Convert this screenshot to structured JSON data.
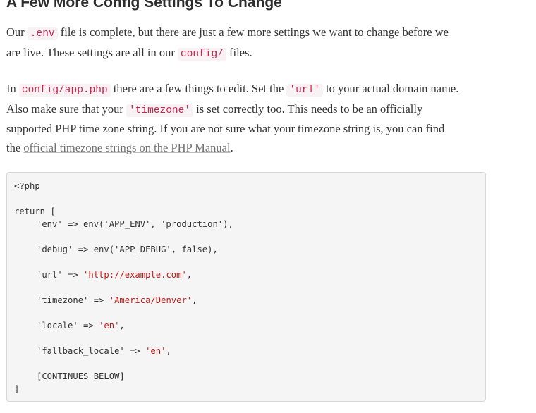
{
  "heading": "A Few More Config Settings To Change",
  "para1": {
    "line1": {
      "t1": "Our ",
      "c1": ".env",
      "t2": " file is complete, but there are just a few more settings we want to change before we"
    },
    "line2": {
      "t1": "are live. These settings are all in our ",
      "c1": "config/",
      "t2": " files."
    }
  },
  "para2": {
    "line1": {
      "t1": "In ",
      "c1": "config/app.php",
      "t2": " there are a few things to edit. Set the ",
      "c2": "'url'",
      "t3": " to your actual domain name."
    },
    "line2": {
      "t1": "Also make sure that your ",
      "c1": "'timezone'",
      "t2": " is set correctly too. This needs to be an officially"
    },
    "line3": {
      "t1": "supported PHP time zone string. If you are not sure what your timezone string is, you can find"
    },
    "line4": {
      "t1": "the ",
      "link": "official timezone strings on the PHP Manual",
      "t2": "."
    }
  },
  "code": {
    "open_tag": "<?php",
    "return_line": "return [",
    "env": {
      "key": "'env' => env('APP_ENV', 'production'),"
    },
    "debug": {
      "key": "'debug' => env('APP_DEBUG', false),"
    },
    "url": {
      "key": "'url' => ",
      "val": "'http://example.com'",
      "end": ","
    },
    "timezone": {
      "key": "'timezone' => ",
      "val": "'America/Denver'",
      "end": ","
    },
    "locale": {
      "key": "'locale' => ",
      "val": "'en'",
      "end": ","
    },
    "fallback": {
      "key": "'fallback_locale' => ",
      "val": "'en'",
      "end": ","
    },
    "continues": "[CONTINUES BELOW]",
    "close": "]"
  }
}
